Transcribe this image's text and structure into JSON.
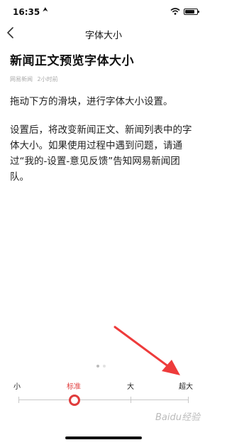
{
  "status_bar": {
    "time": "16:35",
    "location_arrow": "⮝",
    "wifi_icon": "wifi-icon",
    "battery_icon": "battery-icon",
    "battery_level": 0.8
  },
  "nav": {
    "title": "字体大小",
    "back_icon": "chevron-left-icon"
  },
  "article": {
    "headline": "新闻正文预览字体大小",
    "source": "网易新闻",
    "time_ago": "2小时前",
    "paragraphs": [
      "拖动下方的滑块，进行字体大小设置。",
      "设置后，将改变新闻正文、新闻列表中的字体大小。如果使用过程中遇到问题，请通过“我的-设置-意见反馈”告知网易新闻团队。"
    ]
  },
  "pager": {
    "pages": 2,
    "current": 1
  },
  "font_slider": {
    "options": [
      "小",
      "标准",
      "大",
      "超大"
    ],
    "selected_index": 1
  },
  "watermark": "Baidu经验",
  "colors": {
    "accent": "#e03c3c",
    "annotation_arrow": "#ee3b3b",
    "track": "#c8c8c8"
  }
}
